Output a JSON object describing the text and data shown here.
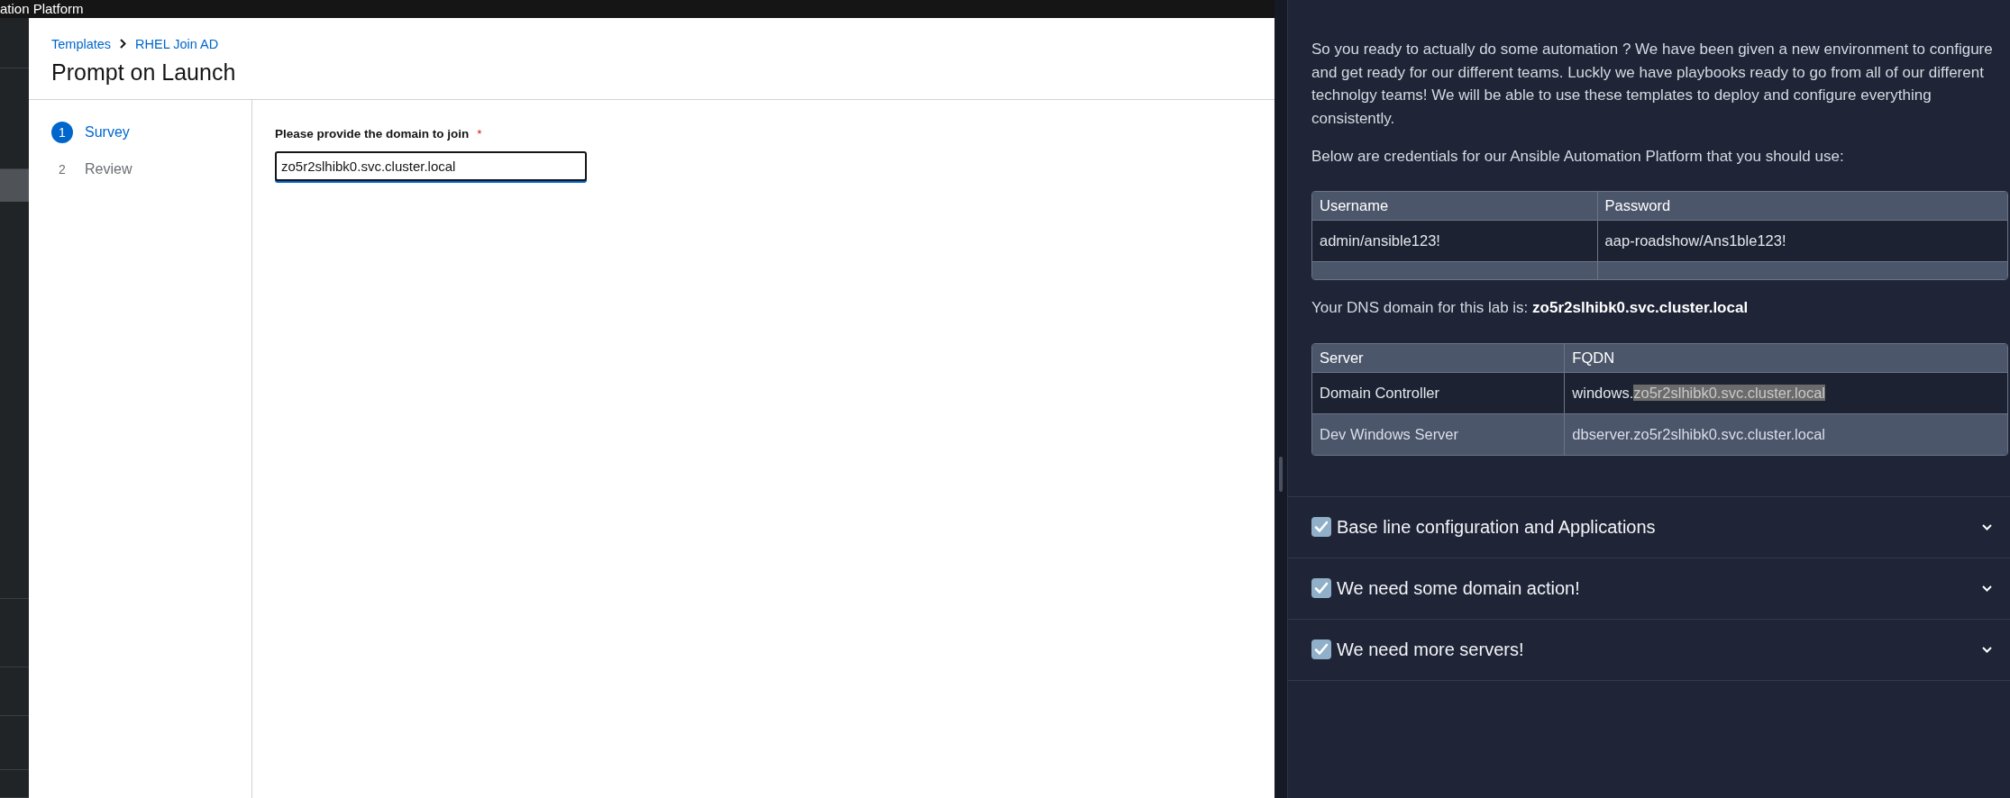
{
  "masthead": {
    "title": "ation Platform"
  },
  "sidebar": {
    "items": [
      {
        "selected": false
      },
      {
        "selected": false
      },
      {
        "selected": true
      },
      {
        "selected": false
      },
      {
        "selected": false
      },
      {
        "selected": false
      },
      {
        "selected": false
      },
      {
        "selected": false
      }
    ]
  },
  "breadcrumbs": [
    "Templates",
    "RHEL Join AD"
  ],
  "page_title": "Prompt on Launch",
  "wizard": {
    "steps": [
      {
        "number": "1",
        "label": "Survey",
        "selected": true
      },
      {
        "number": "2",
        "label": "Review",
        "selected": false
      }
    ]
  },
  "survey": {
    "fields": [
      {
        "label": "Please provide the domain to join",
        "required_mark": "*",
        "value": "zo5r2slhibk0.svc.cluster.local"
      }
    ]
  },
  "instructions": {
    "intro": "So you ready to actually do some automation ? We have been given a new environment to configure and get ready for our different teams. Luckly we have playbooks ready to go from all of our different technolgy teams! We will be able to use these templates to deploy and configure everything consistently.",
    "credentials_intro": "Below are credentials for our Ansible Automation Platform that you should use:",
    "credentials_table": {
      "columns": [
        "Username",
        "Password"
      ],
      "rows": [
        {
          "cells": [
            "admin/ansible123!",
            "aap-roadshow/Ans1ble123!"
          ]
        },
        {
          "empty": true
        }
      ]
    },
    "dns_note": "Your DNS domain for this lab is: **zo5r2slhibk0.svc.cluster.local**",
    "servers_table": {
      "columns": [
        "Server",
        "FQDN"
      ],
      "rows": [
        {
          "cells": [
            "Domain Controller",
            [
              {
                "text": "windows.",
                "highlighted": false
              },
              {
                "text": "zo5r2slhibk0.svc.cluster.local",
                "highlighted": true
              }
            ]
          ]
        },
        {
          "cells": [
            "Dev Windows Server",
            "dbserver.zo5r2slhibk0.svc.cluster.local"
          ]
        }
      ]
    }
  },
  "sections": [
    {
      "title": "Base line configuration and Applications",
      "expanded": false
    },
    {
      "title": "We need some domain action!",
      "expanded": false
    },
    {
      "title": "We need more servers!",
      "expanded": false
    }
  ]
}
